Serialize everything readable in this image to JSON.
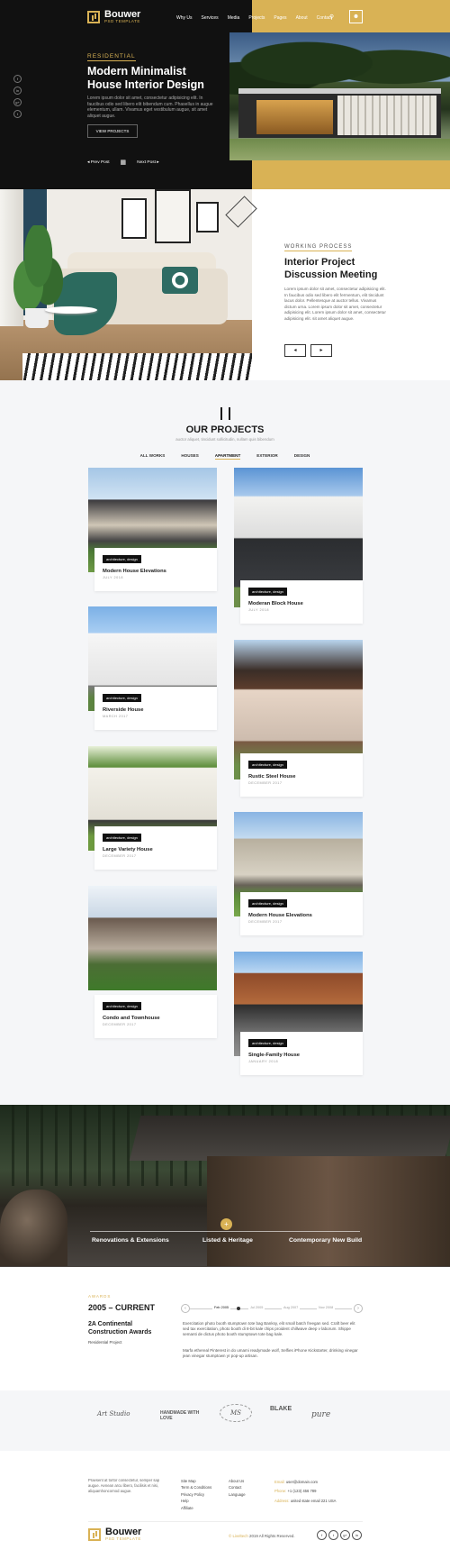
{
  "brand": {
    "name": "Bouwer",
    "tagline": "PSD TEMPLATE"
  },
  "nav": {
    "items": [
      "Why Us",
      "Services",
      "Media",
      "Projects",
      "Pages",
      "About",
      "Contact"
    ],
    "search_icon": "search-icon",
    "user_icon": "user-icon"
  },
  "hero": {
    "eyebrow": "RESIDENTIAL",
    "title": "Modern Minimalist House Interior Design",
    "text": "Lorem ipsum dolor sit amet, consectetur adipisicing elit. In faucibus odio sed libero elit bibendum cum. Phasellus in augue elementum, ullam. Vivamus eget vestibulum augue, sit amet aliquet augue.",
    "button": "VIEW PROJECTS",
    "prev": "Prev Post",
    "next": "Next Post",
    "socials": [
      "f",
      "in",
      "g+",
      "t"
    ]
  },
  "process": {
    "eyebrow": "WORKING PROCESS",
    "title": "Interior Project Discussion Meeting",
    "text": "Lorem ipsum dolor sit amet, consectetur adipisicing elit. In faucibus odio sed libero elit fermentum, elit tincidunt lacus dolor. Pellentesque at auctor tellus. Vivamus dictum urna. Lorem ipsum dolor sit amet, consectetur adipisicing elit. Lorem ipsum dolor sit amet, consectetur adipisicing elit. sit amet aliquet augue.",
    "prev": "◂",
    "next": "▸"
  },
  "projects": {
    "title": "OUR PROJECTS",
    "subtitle": "auctor aliquet, tincidunt sollicitudin, nullam quis bibendum",
    "filters": [
      "ALL WORKS",
      "HOUSES",
      "APARTMENT",
      "EXTERIOR",
      "DESIGN"
    ],
    "active_filter": "APARTMENT",
    "cards": [
      {
        "tag": "architecture, design",
        "title": "Modern House Elevations",
        "date": "JULY 2018"
      },
      {
        "tag": "architecture, design",
        "title": "Moderan Block House",
        "date": "JULY 2018"
      },
      {
        "tag": "architecture, design",
        "title": "Riverside House",
        "date": "MARCH 2017"
      },
      {
        "tag": "architecture, design",
        "title": "Rustic Steel House",
        "date": "DECEMBER 2017"
      },
      {
        "tag": "architecture, design",
        "title": "Large Variety House",
        "date": "DECEMBER 2017"
      },
      {
        "tag": "architecture, design",
        "title": "Modern House Elevations",
        "date": "DECEMBER 2017"
      },
      {
        "tag": "architecture, design",
        "title": "Condo and Townhouse",
        "date": "DECEMBER 2017"
      },
      {
        "tag": "architecture, design",
        "title": "Single-Family House",
        "date": "JANUARY 2018"
      }
    ]
  },
  "banner": {
    "items": [
      "Renovations & Extensions",
      "Listed & Heritage",
      "Contemporary New Build"
    ],
    "plus": "+"
  },
  "awards": {
    "eyebrow": "AWARDS",
    "years": "2005 – CURRENT",
    "title": "2A Continental Construction Awards",
    "sub": "Residential Project",
    "timeline": [
      "Feb 2005",
      "Jul 2005",
      "Aug 2007",
      "Nov 2008"
    ],
    "text1": "Exercitation photo booth stumptown tote bag Banksy, elit small batch freegan sed. Craft beer elit sed tax exercitation, photo booth di 8-bit kale chips proident chillwave deep v laborum. Shippe semanti de dictus photo booth stumptown tote bag kale.",
    "text2": "Marfa ethereal Pinterest in do umami readymade wolf, Selfies iPhone Kickstarter, drinking vinegar jean vinegar stumptown yr pop-up artisan.",
    "prev": "‹",
    "next": "›"
  },
  "clients": [
    "Art Studio",
    "HANDMADE WITH LOVE",
    "MS",
    "BLAKE",
    "pure"
  ],
  "footer": {
    "about": "Praesent at tortor consectetur, semper sap augue. Aenean arcu libero, facilisis et nisi, aliquamhoncornod augue.",
    "col1": [
      "Site Map",
      "Term & Conditions",
      "Privacy Policy",
      "Help",
      "Affiliate"
    ],
    "col2": [
      "About Us",
      "Contact",
      "Language"
    ],
    "contact": [
      {
        "label": "Email:",
        "value": "user@domain.com"
      },
      {
        "label": "Phone:",
        "value": "+1 (123) 456 789"
      },
      {
        "label": "Address:",
        "value": "united state email 221 USA"
      }
    ],
    "copyright_brand": "© Liveltech",
    "copyright": "2019 All Rights Reserved.",
    "socials": [
      "f",
      "t",
      "g+",
      "in"
    ]
  },
  "colors": {
    "accent": "#d9b255",
    "dark": "#111111",
    "light_bg": "#f5f6f8"
  }
}
